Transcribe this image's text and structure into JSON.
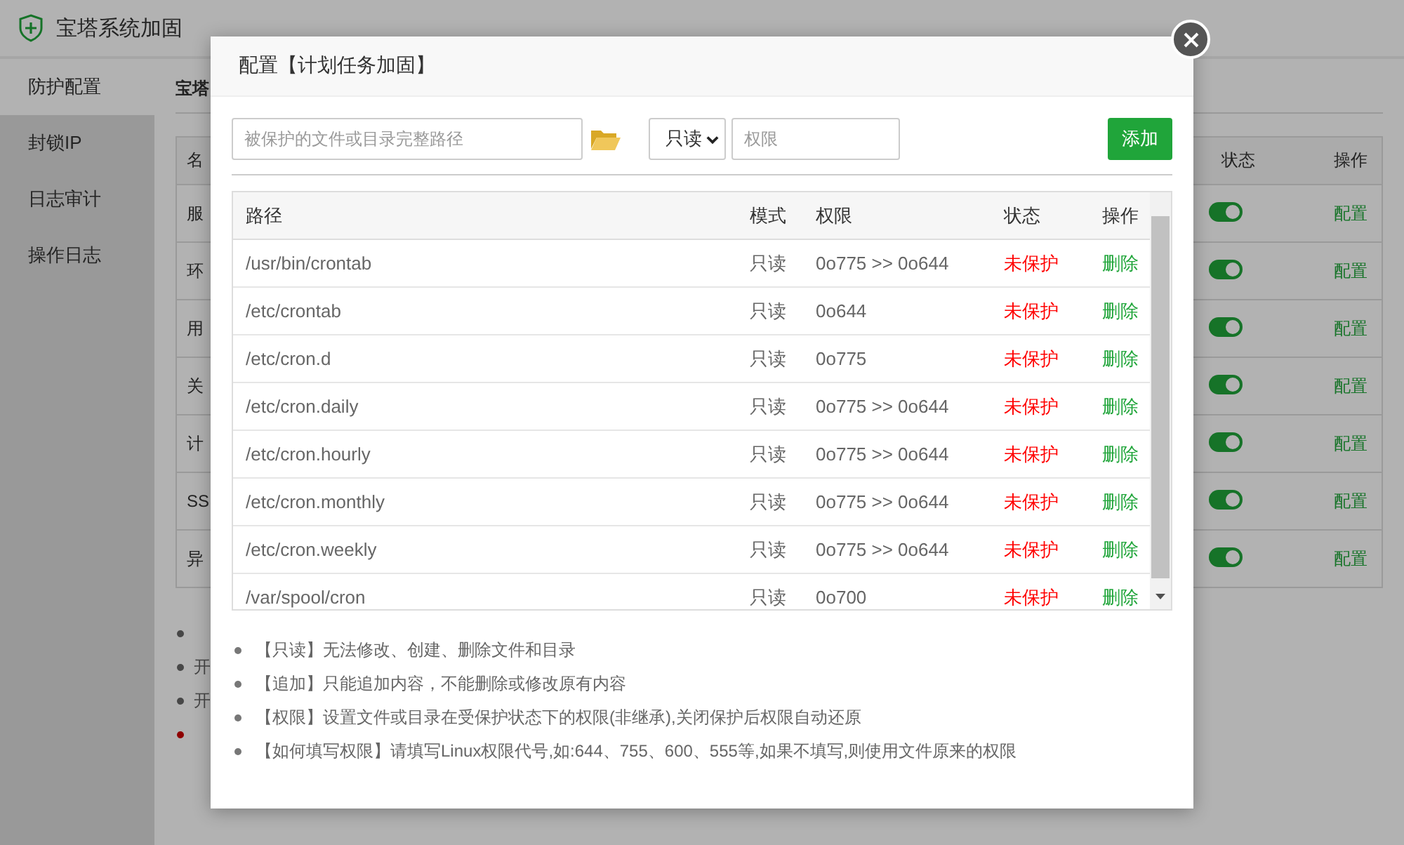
{
  "app": {
    "title": "宝塔系统加固",
    "sidebar": [
      {
        "label": "防护配置",
        "selected": true
      },
      {
        "label": "封锁IP",
        "selected": false
      },
      {
        "label": "日志审计",
        "selected": false
      },
      {
        "label": "操作日志",
        "selected": false
      }
    ],
    "section_title": "宝塔",
    "table": {
      "columns": [
        "名",
        "状态",
        "操作"
      ],
      "rows": [
        {
          "name": "服",
          "on": true,
          "action": "配置"
        },
        {
          "name": "环",
          "on": true,
          "action": "配置"
        },
        {
          "name": "用",
          "on": true,
          "action": "配置"
        },
        {
          "name": "关",
          "on": true,
          "action": "配置"
        },
        {
          "name": "计",
          "on": true,
          "action": "配置"
        },
        {
          "name": "SS",
          "on": true,
          "action": "配置"
        },
        {
          "name": "异",
          "on": true,
          "action": "配置"
        }
      ]
    },
    "notes": [
      {
        "highlight": false
      },
      {
        "text": "开",
        "highlight": false
      },
      {
        "text": "开",
        "highlight": false
      },
      {
        "highlight": true
      }
    ]
  },
  "dialog": {
    "title": "配置【计划任务加固】",
    "path_field": {
      "placeholder": "被保护的文件或目录完整路径"
    },
    "mode_select": {
      "value": "只读"
    },
    "permission_field": {
      "placeholder": "权限"
    },
    "add_button": "添加",
    "table": {
      "columns": [
        "路径",
        "模式",
        "权限",
        "状态",
        "操作"
      ],
      "rows": [
        {
          "path": "/usr/bin/crontab",
          "mode": "只读",
          "permission": "0o775 >> 0o644",
          "status": "未保护",
          "protected": false,
          "action": "删除"
        },
        {
          "path": "/etc/crontab",
          "mode": "只读",
          "permission": "0o644",
          "status": "未保护",
          "protected": false,
          "action": "删除"
        },
        {
          "path": "/etc/cron.d",
          "mode": "只读",
          "permission": "0o775",
          "status": "未保护",
          "protected": false,
          "action": "删除"
        },
        {
          "path": "/etc/cron.daily",
          "mode": "只读",
          "permission": "0o775 >> 0o644",
          "status": "未保护",
          "protected": false,
          "action": "删除"
        },
        {
          "path": "/etc/cron.hourly",
          "mode": "只读",
          "permission": "0o775 >> 0o644",
          "status": "未保护",
          "protected": false,
          "action": "删除"
        },
        {
          "path": "/etc/cron.monthly",
          "mode": "只读",
          "permission": "0o775 >> 0o644",
          "status": "未保护",
          "protected": false,
          "action": "删除"
        },
        {
          "path": "/etc/cron.weekly",
          "mode": "只读",
          "permission": "0o775 >> 0o644",
          "status": "未保护",
          "protected": false,
          "action": "删除"
        },
        {
          "path": "/var/spool/cron",
          "mode": "只读",
          "permission": "0o700",
          "status": "未保护",
          "protected": false,
          "action": "删除"
        }
      ]
    },
    "notes": [
      "【只读】无法修改、创建、删除文件和目录",
      "【追加】只能追加内容，不能删除或修改原有内容",
      "【权限】设置文件或目录在受保护状态下的权限(非继承),关闭保护后权限自动还原",
      "【如何填写权限】请填写Linux权限代号,如:644、755、600、555等,如果不填写,则使用文件原来的权限"
    ]
  }
}
